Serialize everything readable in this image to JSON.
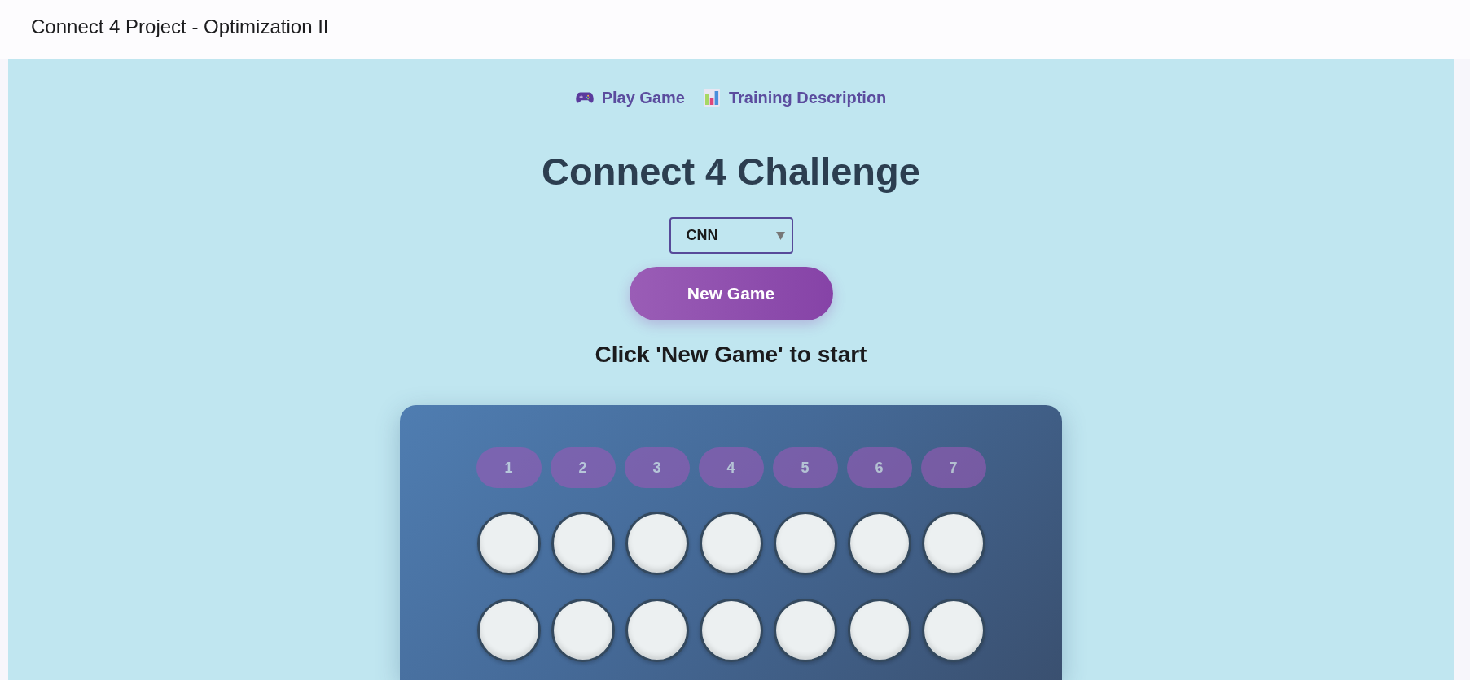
{
  "window": {
    "title": "Connect 4 Project - Optimization II"
  },
  "nav": {
    "links": [
      {
        "label": "Play Game"
      },
      {
        "label": "Training Description"
      }
    ]
  },
  "heading": "Connect 4 Challenge",
  "model_select": {
    "value": "CNN"
  },
  "new_game_button": {
    "label": "New Game"
  },
  "status": "Click 'New Game' to start",
  "board": {
    "columns": [
      {
        "label": "1",
        "disabled": true
      },
      {
        "label": "2",
        "disabled": true
      },
      {
        "label": "3",
        "disabled": true
      },
      {
        "label": "4",
        "disabled": true
      },
      {
        "label": "5",
        "disabled": true
      },
      {
        "label": "6",
        "disabled": true
      },
      {
        "label": "7",
        "disabled": true
      }
    ],
    "rows": [
      {
        "cells": [
          {
            "kind": "empty"
          },
          {
            "kind": "empty"
          },
          {
            "kind": "empty"
          },
          {
            "kind": "empty"
          },
          {
            "kind": "empty"
          },
          {
            "kind": "empty"
          },
          {
            "kind": "empty"
          }
        ]
      },
      {
        "cells": [
          {
            "kind": "empty"
          },
          {
            "kind": "empty"
          },
          {
            "kind": "empty"
          },
          {
            "kind": "empty"
          },
          {
            "kind": "empty"
          },
          {
            "kind": "empty"
          },
          {
            "kind": "empty"
          }
        ]
      }
    ]
  }
}
